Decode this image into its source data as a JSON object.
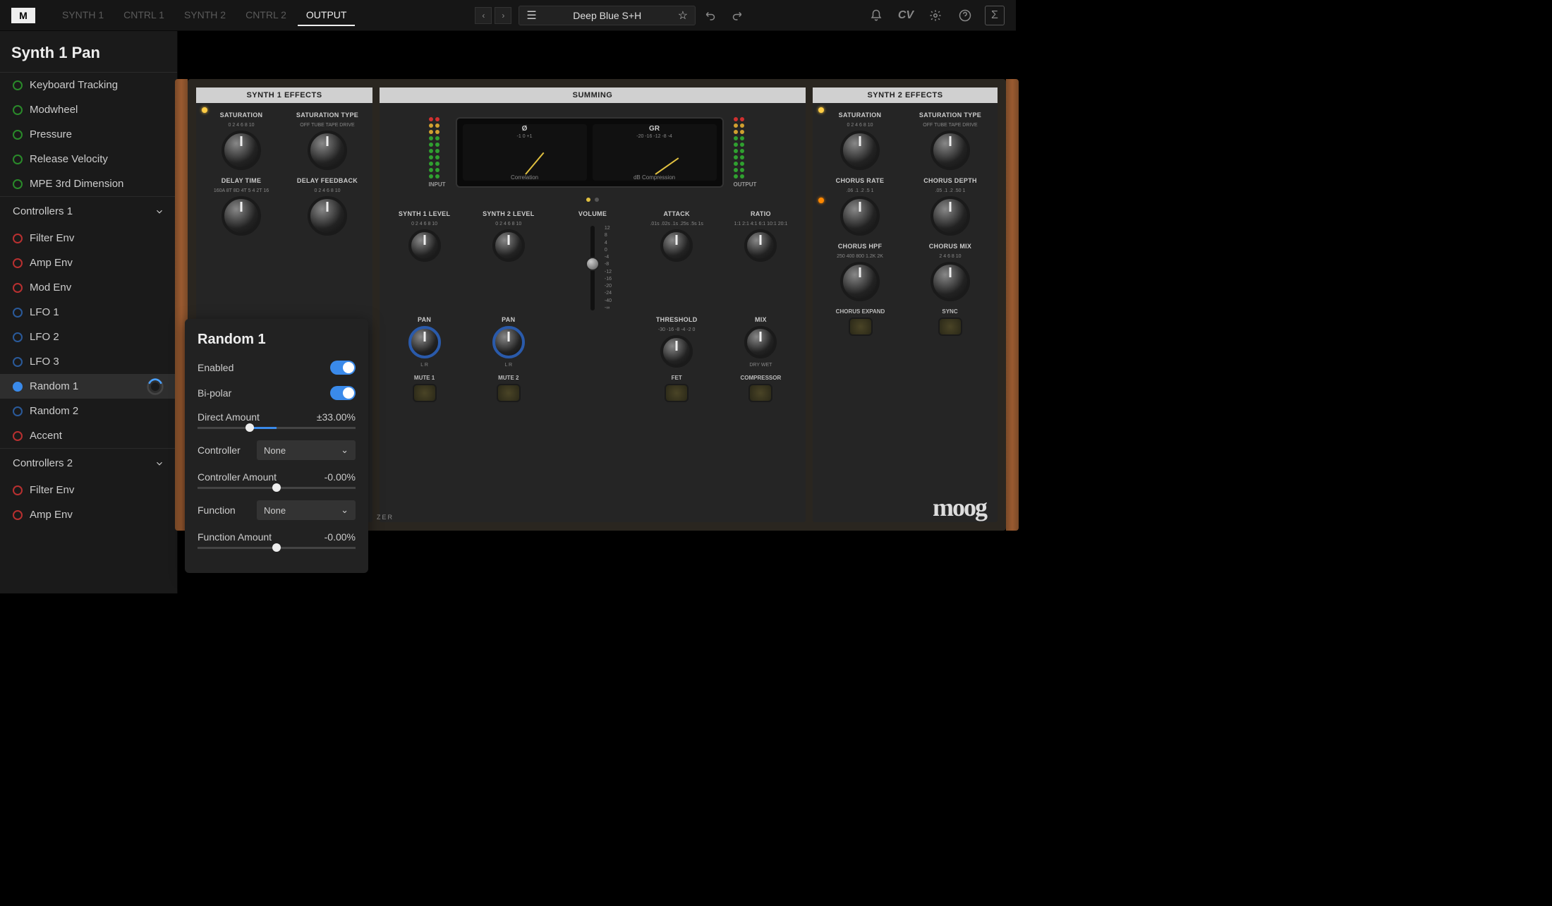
{
  "topbar": {
    "m_label": "M",
    "tabs": [
      "SYNTH 1",
      "CNTRL 1",
      "SYNTH 2",
      "CNTRL 2",
      "OUTPUT"
    ],
    "active_tab": 4,
    "preset_name": "Deep Blue S+H",
    "cv_label": "CV"
  },
  "sidebar": {
    "title": "Synth 1 Pan",
    "group1": [
      {
        "label": "Keyboard Tracking",
        "dot": "green"
      },
      {
        "label": "Modwheel",
        "dot": "green"
      },
      {
        "label": "Pressure",
        "dot": "green"
      },
      {
        "label": "Release Velocity",
        "dot": "green"
      },
      {
        "label": "MPE 3rd Dimension",
        "dot": "green"
      }
    ],
    "section1": "Controllers 1",
    "group2": [
      {
        "label": "Filter Env",
        "dot": "red"
      },
      {
        "label": "Amp Env",
        "dot": "red"
      },
      {
        "label": "Mod Env",
        "dot": "red"
      },
      {
        "label": "LFO 1",
        "dot": "blue-ring"
      },
      {
        "label": "LFO 2",
        "dot": "blue-ring"
      },
      {
        "label": "LFO 3",
        "dot": "blue-ring"
      },
      {
        "label": "Random 1",
        "dot": "blue-fill",
        "selected": true
      },
      {
        "label": "Random 2",
        "dot": "blue-ring"
      },
      {
        "label": "Accent",
        "dot": "red"
      }
    ],
    "section2": "Controllers 2",
    "group3": [
      {
        "label": "Filter Env",
        "dot": "red"
      },
      {
        "label": "Amp Env",
        "dot": "red"
      }
    ]
  },
  "popup": {
    "title": "Random 1",
    "enabled_label": "Enabled",
    "bipolar_label": "Bi-polar",
    "direct_amount_label": "Direct Amount",
    "direct_amount_value": "±33.00%",
    "controller_label": "Controller",
    "controller_value": "None",
    "controller_amount_label": "Controller Amount",
    "controller_amount_value": "-0.00%",
    "function_label": "Function",
    "function_value": "None",
    "function_amount_label": "Function Amount",
    "function_amount_value": "-0.00%"
  },
  "rack": {
    "s1_title": "SYNTH 1 EFFECTS",
    "sum_title": "SUMMING",
    "s2_title": "SYNTH 2 EFFECTS",
    "s1_knobs": [
      {
        "label": "SATURATION",
        "sub": "0  2  4  6  8  10"
      },
      {
        "label": "SATURATION TYPE",
        "sub": "OFF  TUBE  TAPE  DRIVE"
      },
      {
        "label": "DELAY TIME",
        "sub": "160A 8T 8D 4T 5 4 2T 16"
      },
      {
        "label": "DELAY FEEDBACK",
        "sub": "0  2  4  6  8  10"
      }
    ],
    "s2_knobs": [
      {
        "label": "SATURATION",
        "sub": "0  2  4  6  8  10"
      },
      {
        "label": "SATURATION TYPE",
        "sub": "OFF  TUBE  TAPE  DRIVE"
      },
      {
        "label": "CHORUS RATE",
        "sub": ".06 .1 .2 .5 1"
      },
      {
        "label": "CHORUS DEPTH",
        "sub": ".05 .1 .2 .50 1"
      },
      {
        "label": "CHORUS HPF",
        "sub": "250 400 800 1.2K 2K"
      },
      {
        "label": "CHORUS MIX",
        "sub": "2 4 6 8 10"
      }
    ],
    "s2_btns": [
      "CHORUS EXPAND",
      "SYNC"
    ],
    "meters": {
      "input": "INPUT",
      "output": "OUTPUT",
      "phi": "Ø",
      "gr": "GR",
      "corr": "Correlation",
      "dbc": "dB Compression",
      "corr_ticks": "-1    0    +1",
      "gr_ticks": "-20  -16  -12  -8  -4"
    },
    "sum_row1": [
      "SYNTH 1 LEVEL",
      "SYNTH 2 LEVEL",
      "VOLUME",
      "ATTACK",
      "RATIO"
    ],
    "sum_row1_sub": [
      "0 2 4 6 8 10",
      "0 2 4 6 8 10",
      "",
      ".01s .02s .1s .25s .5s 1s",
      "1:1 2:1 4:1 6:1 10:1 20:1"
    ],
    "sum_row2": [
      "PAN",
      "PAN",
      "",
      "THRESHOLD",
      "MIX"
    ],
    "sum_row2_sub": [
      "L        R",
      "L        R",
      "",
      "-30 -16 -8 -4 -2 0",
      "DRY        WET"
    ],
    "vol_scale": [
      "12",
      "8",
      "4",
      "0",
      "-4",
      "-8",
      "-12",
      "-16",
      "-20",
      "-24",
      "-40",
      "-∞"
    ],
    "sum_btns": [
      "MUTE 1",
      "MUTE 2",
      "",
      "FET",
      "COMPRESSOR"
    ],
    "logo": "moog",
    "zer": "ZER"
  }
}
